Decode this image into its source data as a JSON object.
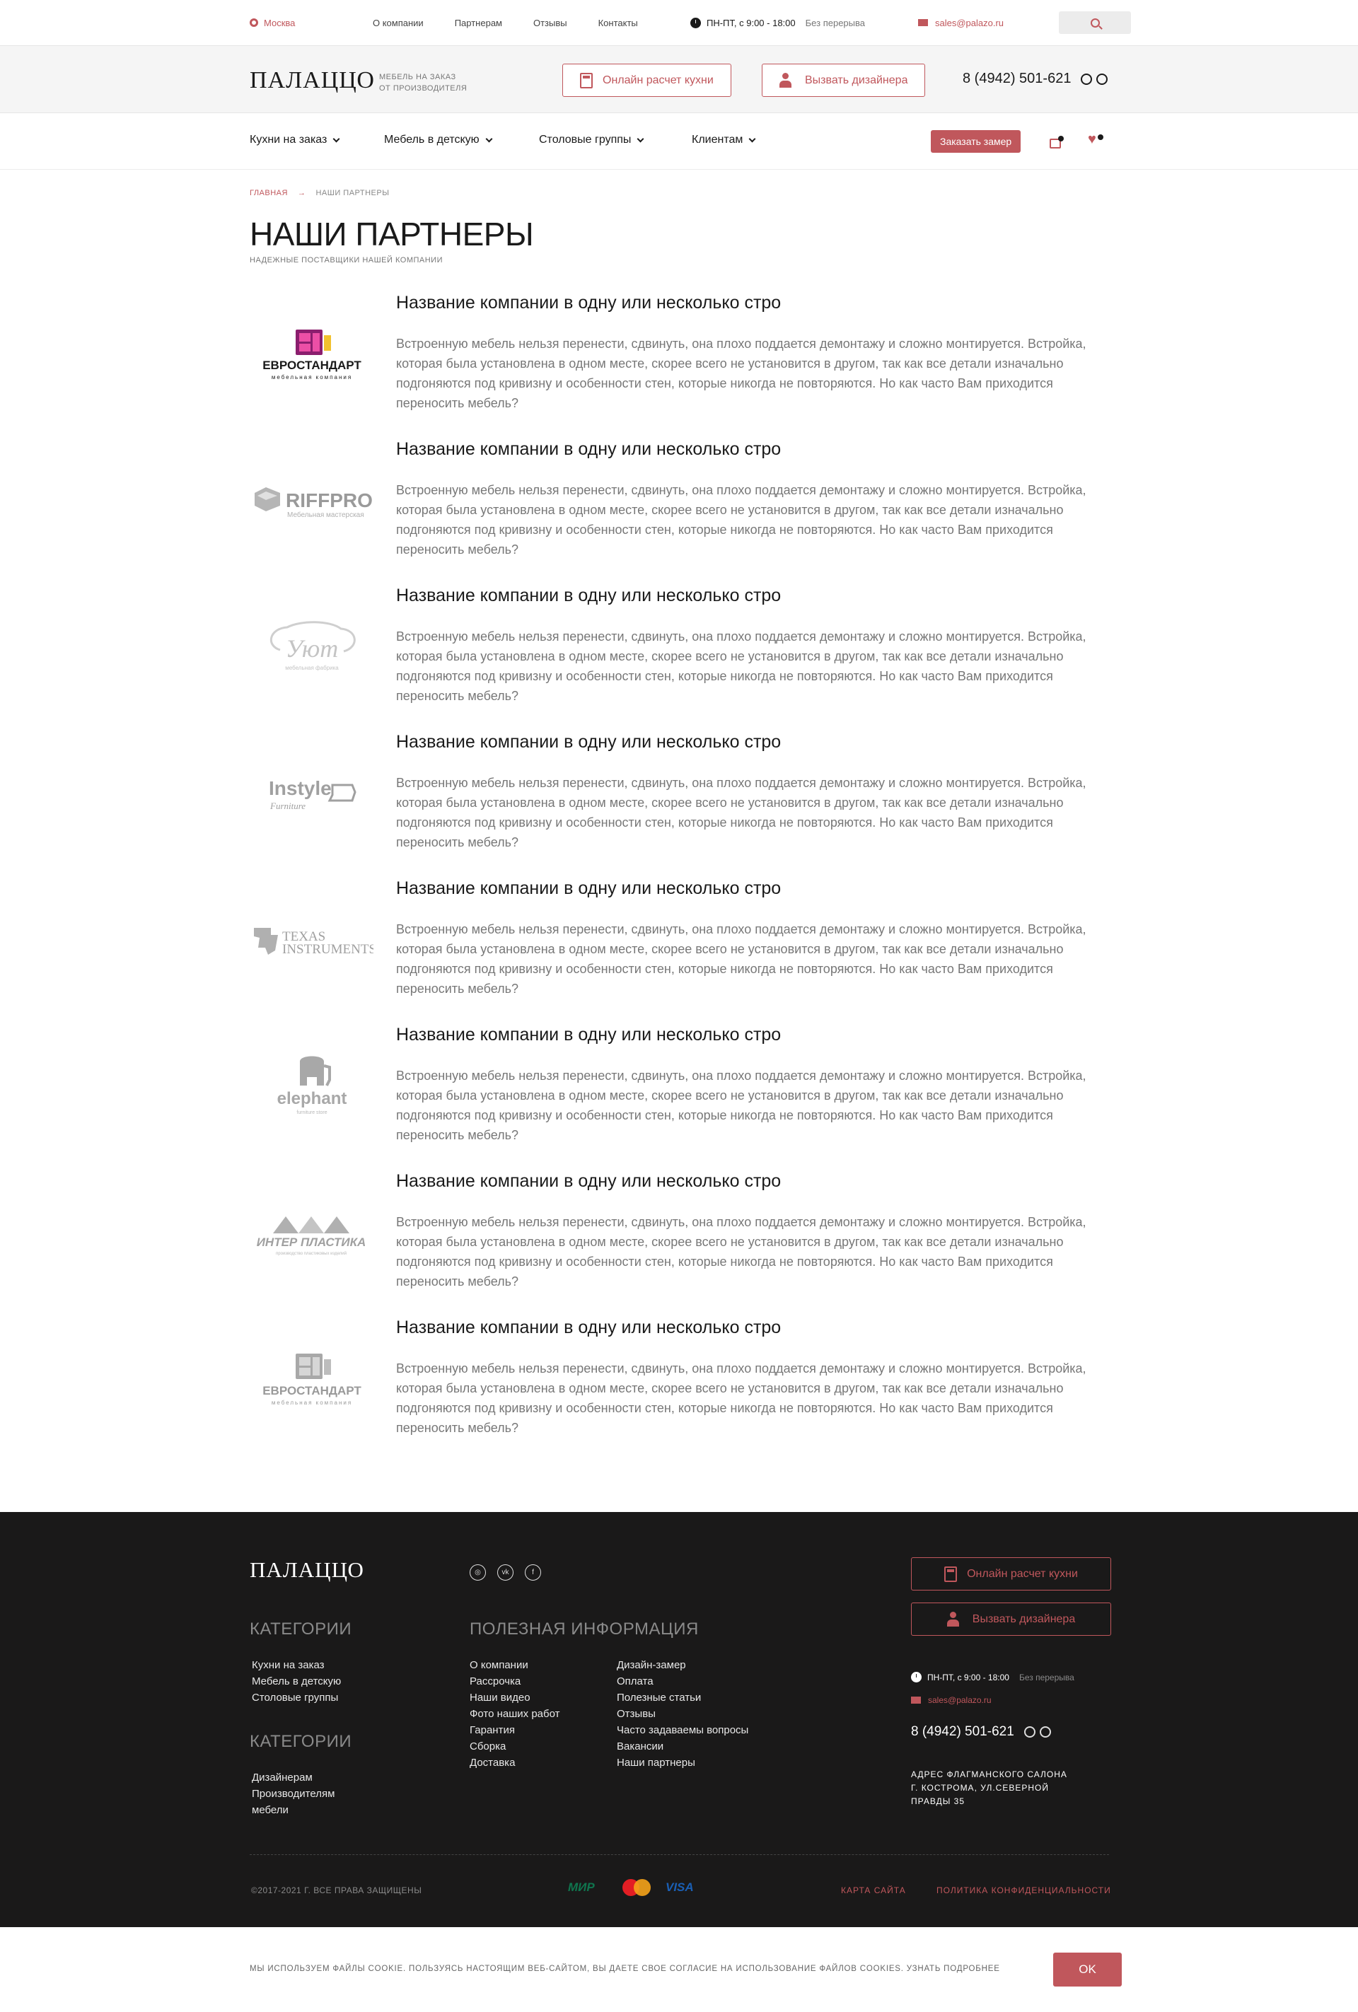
{
  "topbar": {
    "city": "Москва",
    "nav": [
      "О компании",
      "Партнерам",
      "Отзывы",
      "Контакты"
    ],
    "hours": "ПН-ПТ, с 9:00 - 18:00",
    "hours_note": "Без перерыва",
    "email": "sales@palazo.ru"
  },
  "header": {
    "logo": "ПАЛАЦЦО",
    "slogan_line1": "МЕБЕЛЬ НА ЗАКАЗ",
    "slogan_line2": "ОТ ПРОИЗВОДИТЕЛЯ",
    "calc_button": "Онлайн расчет кухни",
    "designer_button": "Вызвать дизайнера",
    "phone": "8 (4942) 501-621"
  },
  "mainnav": {
    "items": [
      "Кухни на заказ",
      "Мебель в детскую",
      "Столовые группы",
      "Клиентам"
    ],
    "measure_button": "Заказать замер"
  },
  "breadcrumb": {
    "home": "ГЛАВНАЯ",
    "sep": "→",
    "current": "НАШИ ПАРТНЕРЫ"
  },
  "page": {
    "title": "НАШИ ПАРТНЕРЫ",
    "subtitle": "НАДЕЖНЫЕ ПОСТАВЩИКИ НАШЕЙ КОМПАНИИ"
  },
  "partners": [
    {
      "logo": "ЕВРОСТАНДАРТ",
      "logo_sub": "мебельная компания",
      "name": "Название компании в одну или несколько стро",
      "desc": "Встроенную мебель нельзя перенести, сдвинуть, она плохо поддается демонтажу и сложно монтируется. Встройка, которая была установлена в одном месте, скорее всего не установится в другом, так как все детали изначально подгоняются под кривизну и особенности стен, которые никогда не повторяются. Но как часто Вам приходится переносить мебель?"
    },
    {
      "logo": "RIFFPRO",
      "logo_sub": "Мебельная мастерская",
      "name": "Название компании в одну или несколько стро",
      "desc": "Встроенную мебель нельзя перенести, сдвинуть, она плохо поддается демонтажу и сложно монтируется. Встройка, которая была установлена в одном месте, скорее всего не установится в другом, так как все детали изначально подгоняются под кривизну и особенности стен, которые никогда не повторяются. Но как часто Вам приходится переносить мебель?"
    },
    {
      "logo": "Уют",
      "logo_sub": "мебельная фабрика",
      "name": "Название компании в одну или несколько стро",
      "desc": "Встроенную мебель нельзя перенести, сдвинуть, она плохо поддается демонтажу и сложно монтируется. Встройка, которая была установлена в одном месте, скорее всего не установится в другом, так как все детали изначально подгоняются под кривизну и особенности стен, которые никогда не повторяются. Но как часто Вам приходится переносить мебель?"
    },
    {
      "logo": "Instyle",
      "logo_sub": "Furniture",
      "name": "Название компании в одну или несколько стро",
      "desc": "Встроенную мебель нельзя перенести, сдвинуть, она плохо поддается демонтажу и сложно монтируется. Встройка, которая была установлена в одном месте, скорее всего не установится в другом, так как все детали изначально подгоняются под кривизну и особенности стен, которые никогда не повторяются. Но как часто Вам приходится переносить мебель?"
    },
    {
      "logo": "TEXAS",
      "logo_sub": "INSTRUMENTS",
      "name": "Название компании в одну или несколько стро",
      "desc": "Встроенную мебель нельзя перенести, сдвинуть, она плохо поддается демонтажу и сложно монтируется. Встройка, которая была установлена в одном месте, скорее всего не установится в другом, так как все детали изначально подгоняются под кривизну и особенности стен, которые никогда не повторяются. Но как часто Вам приходится переносить мебель?"
    },
    {
      "logo": "elephant",
      "logo_sub": "furniture store",
      "name": "Название компании в одну или несколько стро",
      "desc": "Встроенную мебель нельзя перенести, сдвинуть, она плохо поддается демонтажу и сложно монтируется. Встройка, которая была установлена в одном месте, скорее всего не установится в другом, так как все детали изначально подгоняются под кривизну и особенности стен, которые никогда не повторяются. Но как часто Вам приходится переносить мебель?"
    },
    {
      "logo": "ИНТЕР ПЛАСТИКА",
      "logo_sub": "производство пластиковых изделий",
      "name": "Название компании в одну или несколько стро",
      "desc": "Встроенную мебель нельзя перенести, сдвинуть, она плохо поддается демонтажу и сложно монтируется. Встройка, которая была установлена в одном месте, скорее всего не установится в другом, так как все детали изначально подгоняются под кривизну и особенности стен, которые никогда не повторяются. Но как часто Вам приходится переносить мебель?"
    },
    {
      "logo": "ЕВРОСТАНДАРТ",
      "logo_sub": "мебельная компания",
      "name": "Название компании в одну или несколько стро",
      "desc": "Встроенную мебель нельзя перенести, сдвинуть, она плохо поддается демонтажу и сложно монтируется. Встройка, которая была установлена в одном месте, скорее всего не установится в другом, так как все детали изначально подгоняются под кривизну и особенности стен, которые никогда не повторяются. Но как часто Вам приходится переносить мебель?"
    }
  ],
  "footer": {
    "logo": "ПАЛАЦЦО",
    "categories_head": "КАТЕГОРИИ",
    "categories": [
      "Кухни на заказ",
      "Мебель в детскую",
      "Столовые группы"
    ],
    "categories2_head": "КАТЕГОРИИ",
    "categories2": [
      "Дизайнерам",
      "Производителям",
      "мебели"
    ],
    "useful_head": "ПОЛЕЗНАЯ ИНФОРМАЦИЯ",
    "useful_col1": [
      "О компании",
      "Рассрочка",
      "Наши видео",
      "Фото наших работ",
      "Гарантия",
      "Сборка",
      "Доставка"
    ],
    "useful_col2": [
      "Дизайн-замер",
      "Оплата",
      "Полезные статьи",
      "Отзывы",
      "Часто задаваемы вопросы",
      "Вакансии",
      "Наши партнеры"
    ],
    "calc_button": "Онлайн расчет кухни",
    "designer_button": "Вызвать дизайнера",
    "hours": "ПН-ПТ, с 9:00 - 18:00",
    "hours_note": "Без перерыва",
    "email": "sales@palazo.ru",
    "phone": "8 (4942) 501-621",
    "address": "АДРЕС ФЛАГМАНСКОГО САЛОНА Г. КОСТРОМА, УЛ.СЕВЕРНОЙ ПРАВДЫ 35",
    "copyright": "©2017-2021 Г. ВСЕ ПРАВА ЗАЩИЩЕНЫ",
    "pay_mir": "МИР",
    "pay_visa": "VISA",
    "sitemap": "КАРТА САЙТА",
    "privacy": "ПОЛИТИКА КОНФИДЕНЦИАЛЬНОСТИ"
  },
  "cookie": {
    "text": "МЫ ИСПОЛЬЗУЕМ ФАЙЛЫ COOKIE. ПОЛЬЗУЯСЬ НАСТОЯЩИМ ВЕБ-САЙТОМ, ВЫ ДАЕТЕ СВОЕ СОГЛАСИЕ НА ИСПОЛЬЗОВАНИЕ ФАЙЛОВ COOKIES. УЗНАТЬ ПОДРОБНЕЕ",
    "ok": "OK"
  },
  "colors": {
    "accent": "#c0575c",
    "footer_bg": "#1a1919"
  }
}
